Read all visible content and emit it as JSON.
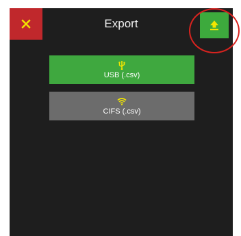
{
  "header": {
    "title": "Export",
    "close_icon": "close-icon",
    "export_icon": "upload-icon"
  },
  "options": [
    {
      "label": "USB (.csv)",
      "icon": "usb-icon",
      "color": "#3fa83f"
    },
    {
      "label": "CIFS (.csv)",
      "icon": "wifi-icon",
      "color": "#6c6c6c"
    }
  ],
  "colors": {
    "background": "#1e1e1e",
    "close": "#c0282c",
    "accent_green": "#3daa3d",
    "icon_yellow": "#f2e600",
    "highlight": "#d9231f"
  }
}
